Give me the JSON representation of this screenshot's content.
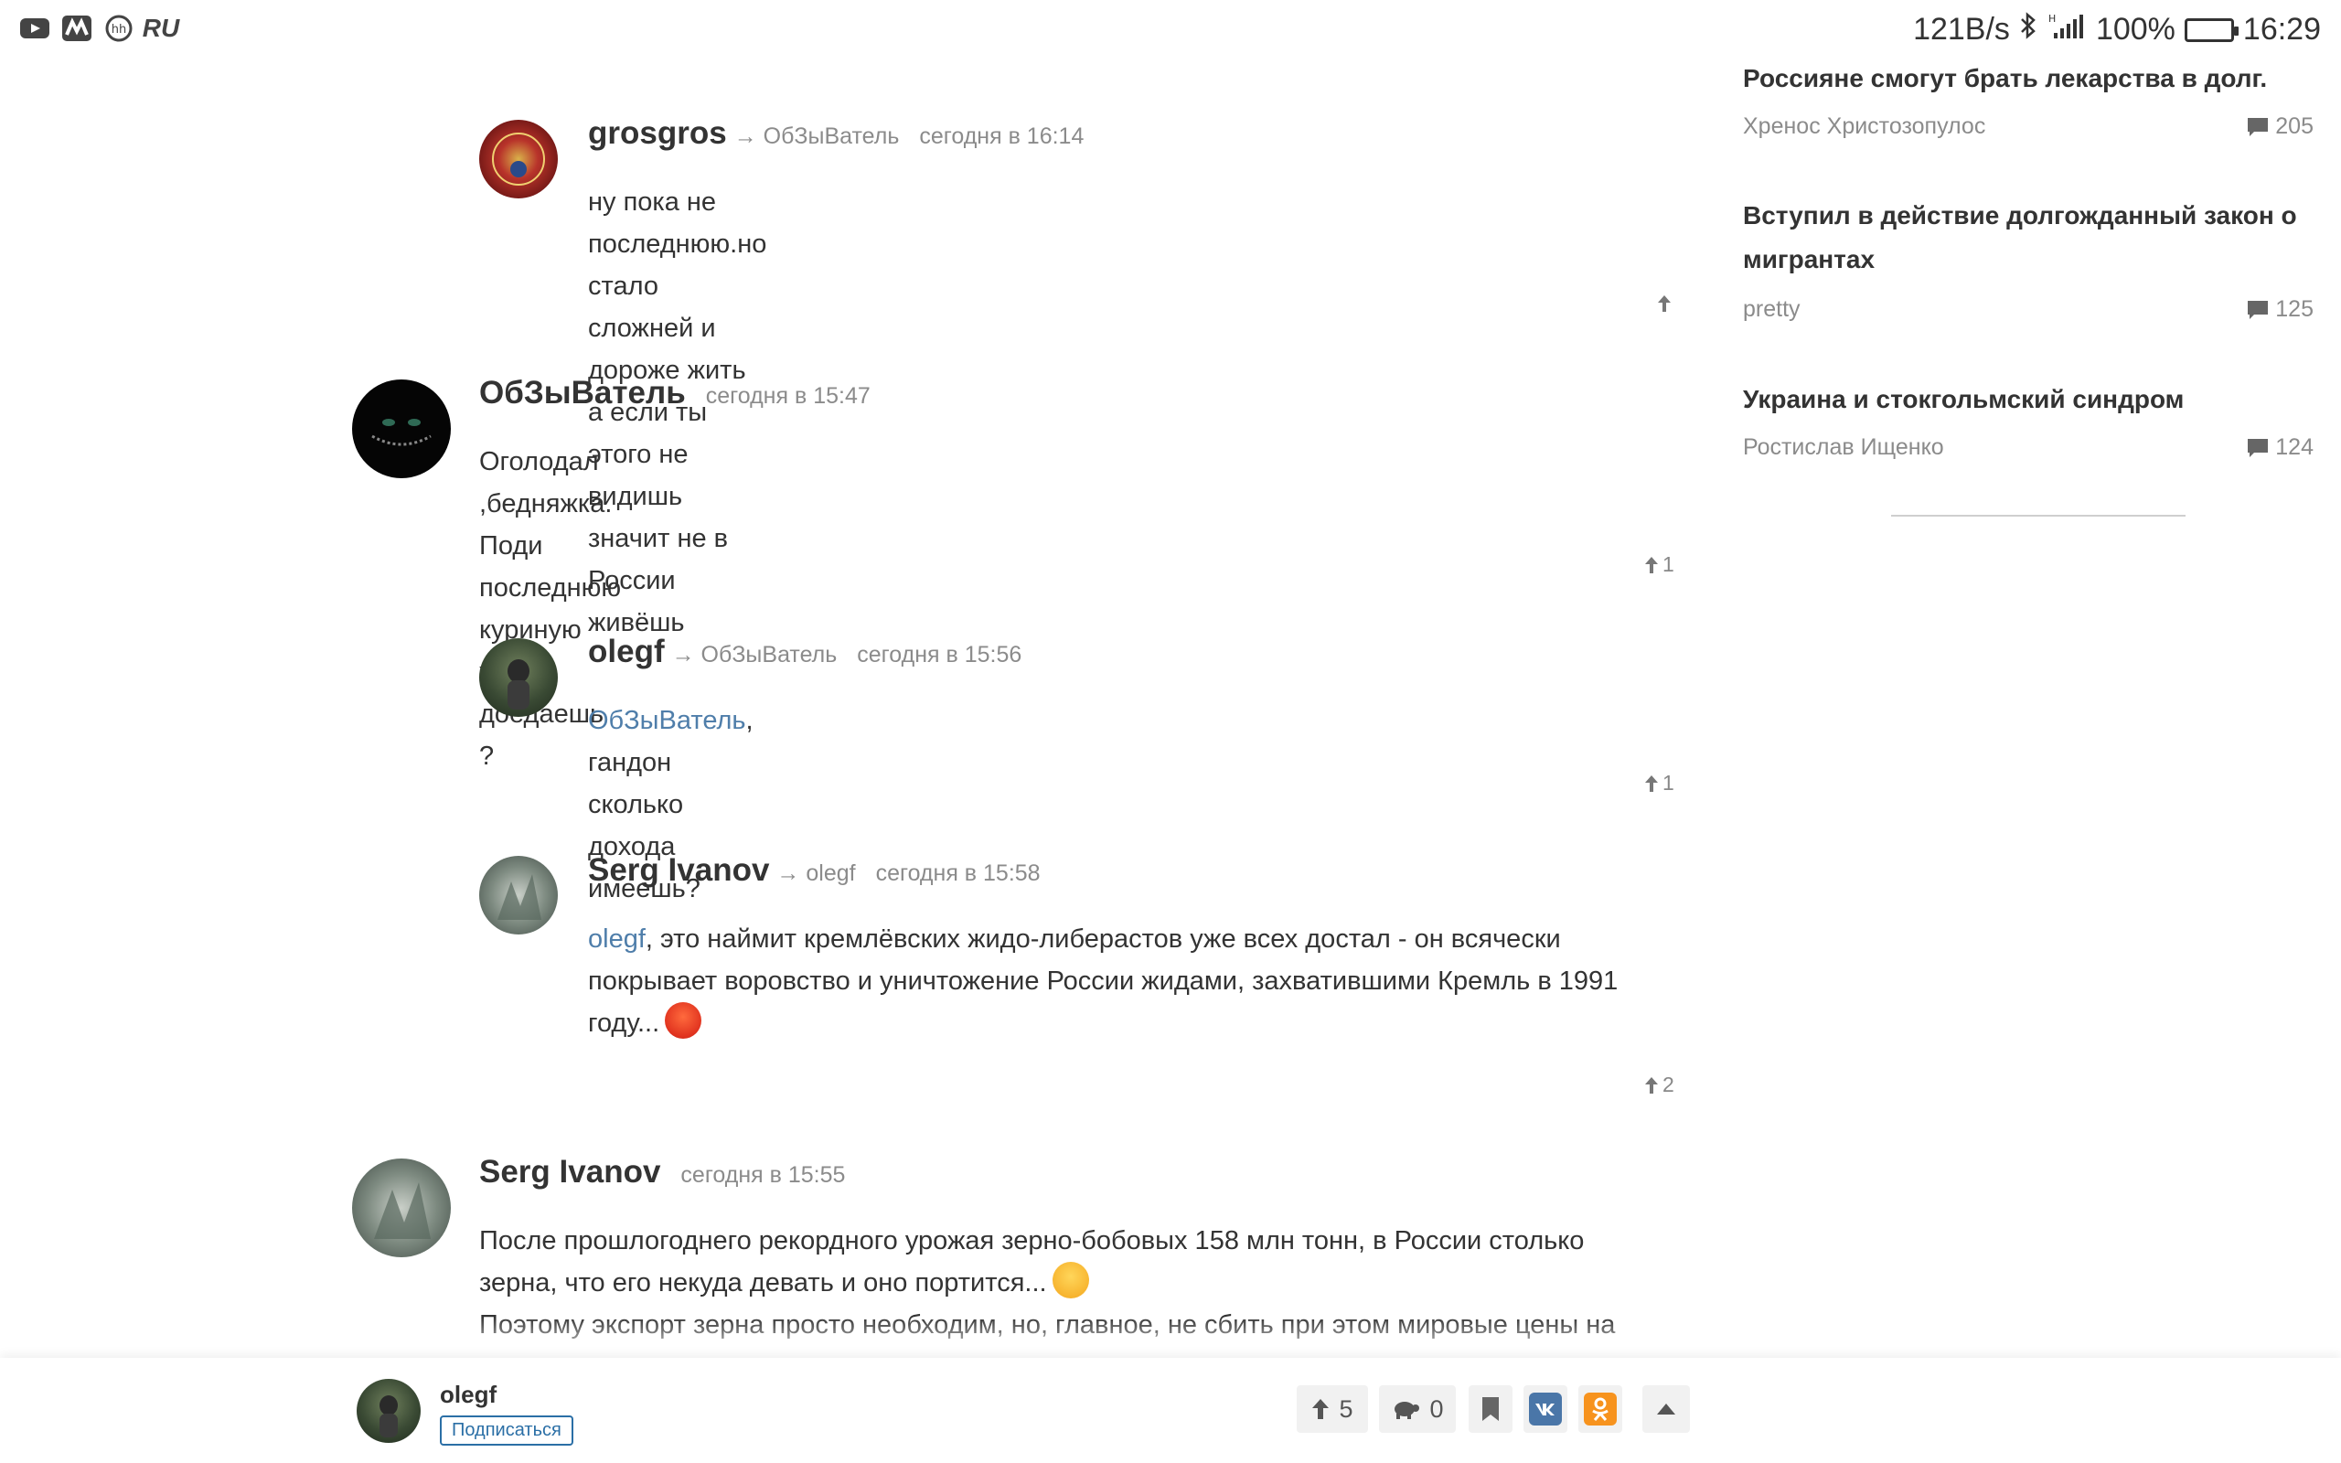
{
  "status_bar": {
    "net_speed": "121B/s",
    "battery_pct": "100%",
    "time": "16:29",
    "left_icons": [
      "youtube-icon",
      "app-logo-icon",
      "hh-icon",
      "ru-icon"
    ],
    "ru_label": "RU",
    "hh_label": "hh"
  },
  "comments": [
    {
      "author": "grosgros",
      "reply_to": "→ ОбЗыВатель",
      "time": "сегодня в 16:14",
      "lines": [
        "ну пока не последнюю.но стало сложней и дороже жить",
        "а если ты этого не видишь значит не в России живёшь"
      ],
      "votes": ""
    },
    {
      "author": "ОбЗыВатель",
      "reply_to": "",
      "time": "сегодня в 15:47",
      "lines": [
        "Оголодал ,бедняжка.",
        "Поди последнюю куриную жопку доедаешь ?"
      ],
      "votes": "1"
    },
    {
      "author": "olegf",
      "reply_to": "→ ОбЗыВатель",
      "time": "сегодня в 15:56",
      "mention": "ОбЗыВатель",
      "text": ", гандон сколько дохода имеешь?",
      "votes": "1"
    },
    {
      "author": "Serg Ivanov",
      "reply_to": "→ olegf",
      "time": "сегодня в 15:58",
      "mention": "olegf",
      "text_line1": ", это наймит кремлёвских жидо-либерастов уже всех достал - он всячески",
      "text_line2": "покрывает воровство и уничтожение России жидами, захватившими Кремль в 1991",
      "text_line3": "году...",
      "votes": "2"
    },
    {
      "author": "Serg Ivanov",
      "reply_to": "",
      "time": "сегодня в 15:55",
      "line1": "После прошлогоднего рекордного урожая зерно-бобовых 158 млн тонн, в России столько",
      "line2": "зерна, что его некуда девать и оно портится...",
      "line3": "Поэтому экспорт зерна просто необходим, но, главное, не сбить при этом мировые цены на"
    }
  ],
  "sidebar": [
    {
      "title": "Россияне смогут брать лекарства в долг.",
      "author": "Хренос Христозопулос",
      "comments": "205"
    },
    {
      "title_line1": "Вступил в действие долгожданный закон о",
      "title_line2": "мигрантах",
      "author": "pretty",
      "comments": "125"
    },
    {
      "title": "Украина и стокгольмский синдром",
      "author": "Ростислав Ищенко",
      "comments": "124"
    }
  ],
  "bottom_bar": {
    "author": "olegf",
    "subscribe_label": "Подписаться",
    "likes": "5",
    "dislikes": "0"
  },
  "colors": {
    "link": "#4f7eaa",
    "meta": "#8b8b8b",
    "subscribe": "#2b6fa6",
    "battery": "#27c84a"
  }
}
